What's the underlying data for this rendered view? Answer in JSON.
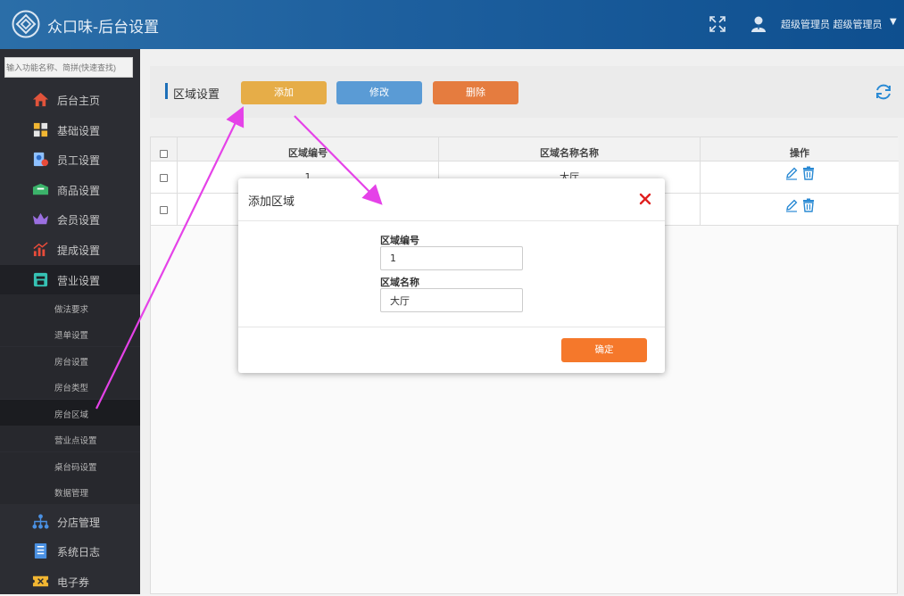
{
  "header": {
    "title": "众口味-后台设置",
    "user": "超级管理员 超级管理员",
    "caret": "▼"
  },
  "sidebar": {
    "search_placeholder": "输入功能名称、简拼(快速查找)",
    "items": [
      {
        "label": "后台主页",
        "icon": "home-icon"
      },
      {
        "label": "基础设置",
        "icon": "puzzle-icon"
      },
      {
        "label": "员工设置",
        "icon": "employee-icon"
      },
      {
        "label": "商品设置",
        "icon": "box-icon"
      },
      {
        "label": "会员设置",
        "icon": "crown-icon"
      },
      {
        "label": "提成设置",
        "icon": "chart-icon"
      },
      {
        "label": "营业设置",
        "icon": "store-icon"
      },
      {
        "label": "分店管理",
        "icon": "branch-icon"
      },
      {
        "label": "系统日志",
        "icon": "log-icon"
      },
      {
        "label": "电子券",
        "icon": "coupon-icon"
      }
    ],
    "sub_items": [
      {
        "label": "做法要求"
      },
      {
        "label": "退单设置"
      },
      {
        "label": "房台设置"
      },
      {
        "label": "房台类型"
      },
      {
        "label": "房台区域"
      },
      {
        "label": "营业点设置"
      },
      {
        "label": "桌台码设置"
      },
      {
        "label": "数据管理"
      }
    ]
  },
  "toolbar": {
    "title": "区域设置",
    "add_label": "添加",
    "edit_label": "修改",
    "delete_label": "删除"
  },
  "table": {
    "headers": [
      "区域编号",
      "区域名称名称",
      "操作"
    ],
    "rows": [
      {
        "code": "1",
        "name": "大厅"
      },
      {
        "code": "",
        "name": ""
      }
    ]
  },
  "modal": {
    "title": "添加区域",
    "code_label": "区域编号",
    "code_value": "1",
    "name_label": "区域名称",
    "name_value": "大厅",
    "confirm_label": "确定"
  },
  "colors": {
    "header_blue": "#1d5f9e",
    "sidebar_bg": "#2c2d33",
    "add_button": "#e6ad48",
    "edit_button": "#5a9bd5",
    "delete_button": "#e57c3f",
    "confirm_button": "#f5782b",
    "annotation_arrow": "#e542e8",
    "close_red": "#e0201f"
  }
}
